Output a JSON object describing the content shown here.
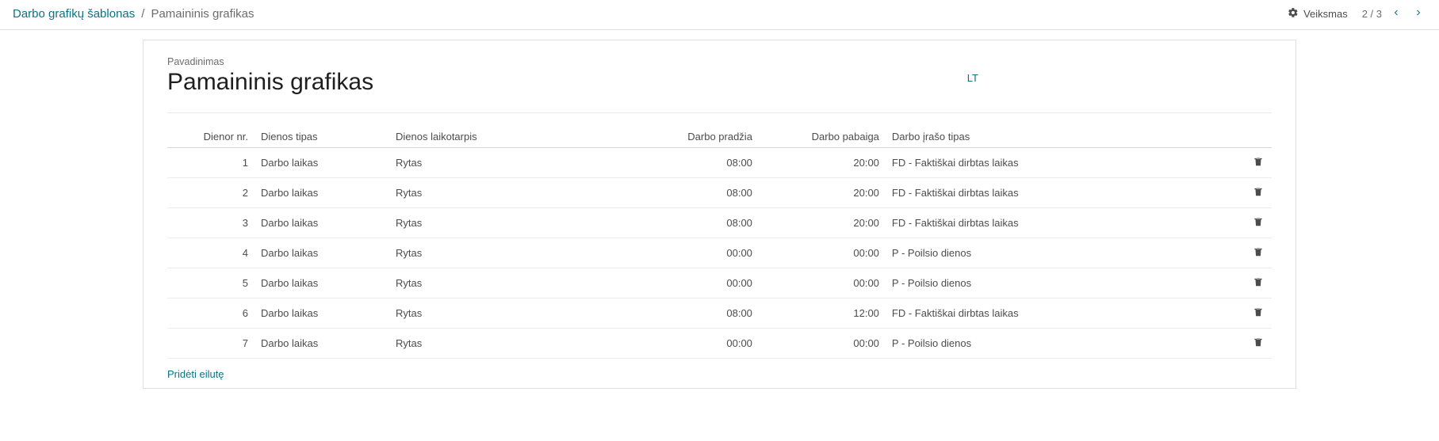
{
  "breadcrumb": {
    "root": "Darbo grafikų šablonas",
    "current": "Pamaininis grafikas"
  },
  "header": {
    "action_label": "Veiksmas",
    "pager": "2 / 3"
  },
  "form": {
    "name_label": "Pavadinimas",
    "name_value": "Pamaininis grafikas",
    "lang_badge": "LT"
  },
  "table": {
    "columns": {
      "day_nr": "Dienor nr.",
      "day_type": "Dienos tipas",
      "day_period": "Dienos laikotarpis",
      "work_start": "Darbo pradžia",
      "work_end": "Darbo pabaiga",
      "entry_type": "Darbo įrašo tipas"
    },
    "rows": [
      {
        "nr": "1",
        "type": "Darbo laikas",
        "period": "Rytas",
        "start": "08:00",
        "end": "20:00",
        "entry": "FD - Faktiškai dirbtas laikas"
      },
      {
        "nr": "2",
        "type": "Darbo laikas",
        "period": "Rytas",
        "start": "08:00",
        "end": "20:00",
        "entry": "FD - Faktiškai dirbtas laikas"
      },
      {
        "nr": "3",
        "type": "Darbo laikas",
        "period": "Rytas",
        "start": "08:00",
        "end": "20:00",
        "entry": "FD - Faktiškai dirbtas laikas"
      },
      {
        "nr": "4",
        "type": "Darbo laikas",
        "period": "Rytas",
        "start": "00:00",
        "end": "00:00",
        "entry": "P - Poilsio dienos"
      },
      {
        "nr": "5",
        "type": "Darbo laikas",
        "period": "Rytas",
        "start": "00:00",
        "end": "00:00",
        "entry": "P - Poilsio dienos"
      },
      {
        "nr": "6",
        "type": "Darbo laikas",
        "period": "Rytas",
        "start": "08:00",
        "end": "12:00",
        "entry": "FD - Faktiškai dirbtas laikas"
      },
      {
        "nr": "7",
        "type": "Darbo laikas",
        "period": "Rytas",
        "start": "00:00",
        "end": "00:00",
        "entry": "P - Poilsio dienos"
      }
    ],
    "add_line": "Pridėti eilutę"
  }
}
